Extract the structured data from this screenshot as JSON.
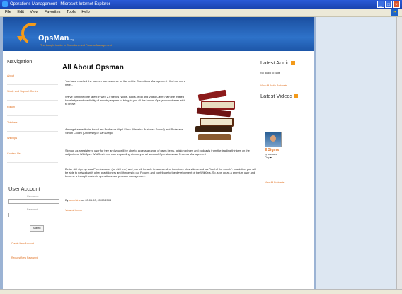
{
  "window": {
    "title": "Operations Management - Microsoft Internet Explorer"
  },
  "menu": [
    "File",
    "Edit",
    "View",
    "Favorites",
    "Tools",
    "Help"
  ],
  "header": {
    "logo": "OpsMan",
    "logo_suffix": ".org",
    "tagline": "The thought leader in Operations and Process Management"
  },
  "nav": {
    "title": "Navigation",
    "items": [
      "About",
      "Study and Support Centre",
      "Forum",
      "Thinkers",
      "WikiOps",
      "Contact Us"
    ]
  },
  "account": {
    "title": "User Account",
    "username_label": "Username:",
    "password_label": "Password:",
    "login": "Submit",
    "create": "Create New Account",
    "forgot": "Request New Password"
  },
  "main": {
    "title": "All About Opsman",
    "p1": "You have reached the number one resource on the net for Operations Management - find out more here...",
    "p2": "We've combined the latest in web 2.0 trends (Wikis, Blogs, iPod and Video Casts) with the trusted knowledge and credibility of industry experts to bring to you all the info on Ops you could ever wish to know!",
    "p3": "Amongst are editorial board are Professor Nigel Slack (Warwick Business School) and Professor Simon Croom (University of San Diego)",
    "p4": "Sign up as a registered user for free and you will be able to access a range of news items, opinion pieces and podcasts from the leading thinkers on the subject and WikiOps - WikiOps is our ever expanding directory of all areas of Operations and Process Management",
    "p5": "Better still sign up as a Premium user (for ##0 p.a.) and you will be able to access all of the above plus videos and our \"tool of the month\". In addition you will be able to network with other practitioners and thinkers in our Forums and contribute to the development of the WikiOps. So, sign up as a premium user and become a thought leader in operations and process management.",
    "byline_prefix": "By",
    "author": "a.m.rhine",
    "byline_date": "on 03:05:00, 05/07/2008",
    "view_all": "View all items"
  },
  "right": {
    "audio_title": "Latest Audio",
    "audio_text": "No audio to date",
    "audio_link": "View All Audio Podcasts",
    "videos_title": "Latest Videos",
    "video_name": "E Sigma",
    "video_by": "by Ravi Mehr",
    "video_play": "Play ▶",
    "videos_link": "View All Podcasts"
  }
}
